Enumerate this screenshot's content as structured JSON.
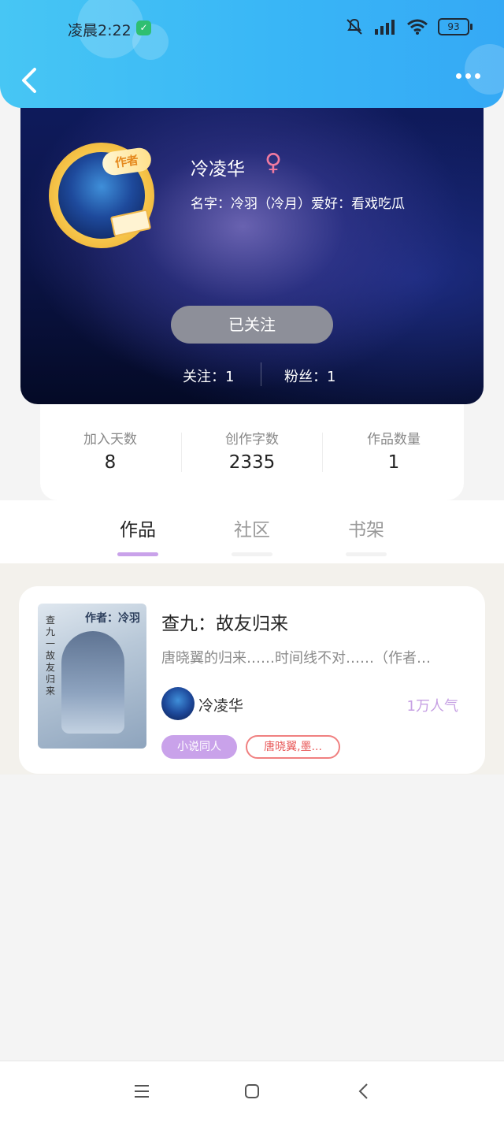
{
  "status_bar": {
    "time": "凌晨2:22",
    "battery": "93"
  },
  "profile": {
    "name": "冷凌华",
    "gender_symbol": "♀",
    "author_badge": "作者",
    "description": "名字：冷羽（冷月）爱好：看戏吃瓜",
    "follow_button": "已关注",
    "following_label": "关注：1",
    "followers_label": "粉丝：1"
  },
  "stats": [
    {
      "label": "加入天数",
      "value": "8"
    },
    {
      "label": "创作字数",
      "value": "2335"
    },
    {
      "label": "作品数量",
      "value": "1"
    }
  ],
  "tabs": [
    {
      "label": "作品",
      "active": true
    },
    {
      "label": "社区",
      "active": false
    },
    {
      "label": "书架",
      "active": false
    }
  ],
  "work": {
    "title": "查九：故友归来",
    "description": "唐晓翼的归来……时间线不对……（作者…",
    "author": "冷凌华",
    "popularity": "1万人气",
    "tags": [
      "小说同人",
      "唐晓翼,墨..."
    ],
    "cover_text_left": "查九一故友归来",
    "cover_text_right": "作者：冷羽"
  },
  "colors": {
    "header": "#3bb8f6",
    "accent_purple": "#c9a2ea",
    "tag_red": "#e85a5a",
    "follow_button": "#8d8f99"
  }
}
